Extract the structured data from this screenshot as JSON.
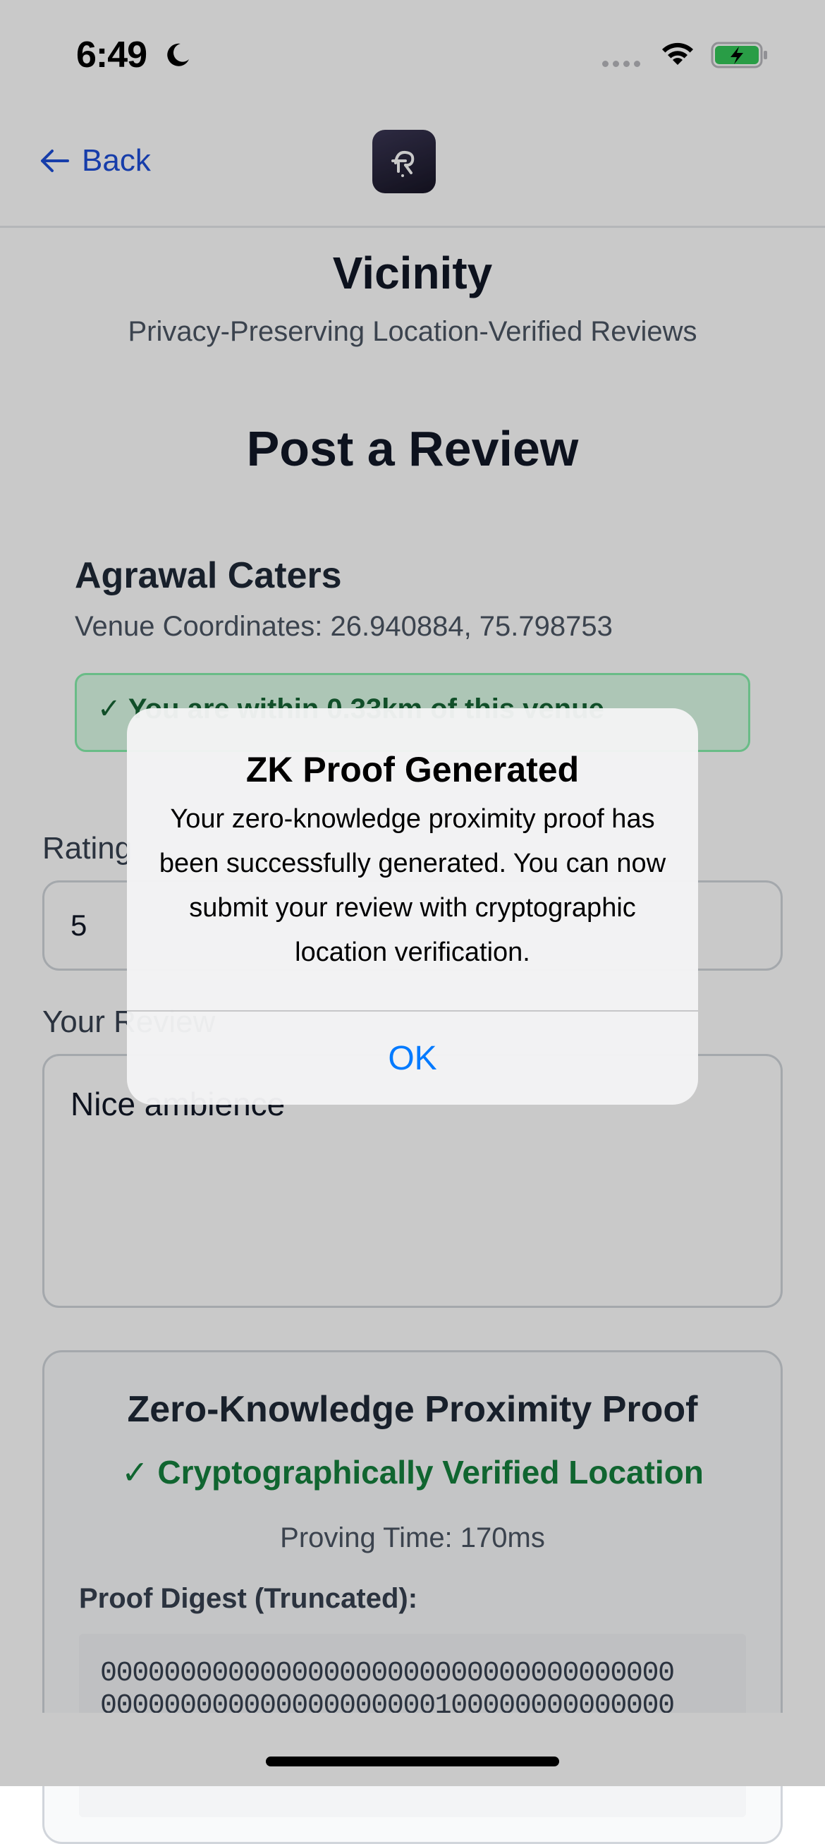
{
  "status_bar": {
    "time": "6:49",
    "icons": [
      "moon-icon",
      "cellular-signal-icon",
      "wifi-icon",
      "battery-charging-icon"
    ]
  },
  "nav": {
    "back_label": "Back",
    "back_icon": "arrow-left-icon",
    "logo_icon": "app-logo-icon"
  },
  "header": {
    "app_title": "Vicinity",
    "app_subtitle": "Privacy-Preserving Location-Verified Reviews",
    "page_heading": "Post a Review"
  },
  "venue": {
    "name": "Agrawal Caters",
    "coords_label": "Venue Coordinates:",
    "coords_value": "26.940884, 75.798753",
    "proximity_text": "✓ You are within 0.33km of this venue"
  },
  "form": {
    "rating_label": "Rating",
    "rating_value": "5",
    "review_label": "Your Review",
    "review_value": "Nice ambience"
  },
  "proof": {
    "title": "Zero-Knowledge Proximity Proof",
    "verified_text": "✓ Cryptographically Verified Location",
    "proving_time": "Proving Time: 170ms",
    "digest_label": "Proof Digest (Truncated):",
    "digest_line1": "000000000000000000000000000000000000",
    "digest_line2": "000000000000000000000100000000000000"
  },
  "alert": {
    "title": "ZK Proof Generated",
    "message": "Your zero-knowledge proximity proof has been successfully generated. You can now submit your review with cryptographic location verification.",
    "ok_label": "OK"
  },
  "colors": {
    "link_blue": "#1d4ed8",
    "ios_blue": "#007aff",
    "success_green": "#15803d",
    "success_bg": "#dcfce7",
    "battery_green": "#34c759"
  }
}
